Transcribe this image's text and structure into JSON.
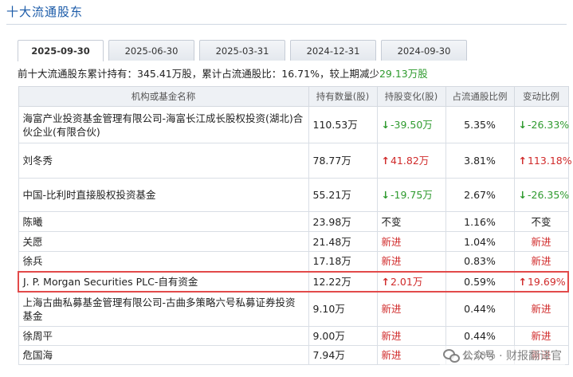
{
  "panel": {
    "title": "十大流通股东"
  },
  "tabs": [
    {
      "label": "2025-09-30",
      "active": true
    },
    {
      "label": "2025-06-30",
      "active": false
    },
    {
      "label": "2025-03-31",
      "active": false
    },
    {
      "label": "2024-12-31",
      "active": false
    },
    {
      "label": "2024-09-30",
      "active": false
    }
  ],
  "summary": {
    "prefix": "前十大流通股东累计持有：",
    "total": "345.41万股",
    "ratio_label": "，累计占流通股比：",
    "ratio": "16.71%",
    "change_label": "，较上期减少",
    "change": "29.13万股"
  },
  "table": {
    "headers": [
      "机构或基金名称",
      "持有数量(股)",
      "持股变化(股)",
      "占流通股比例",
      "变动比例"
    ],
    "rows": [
      {
        "name": "海富产业投资基金管理有限公司-海富长江成长股权投资(湖北)合伙企业(有限合伙)",
        "qty": "110.53万",
        "change": "-39.50万",
        "change_dir": "down",
        "pct": "5.35%",
        "ratio": "-26.33%",
        "ratio_dir": "down"
      },
      {
        "name": "刘冬秀",
        "qty": "78.77万",
        "change": "41.82万",
        "change_dir": "up",
        "pct": "3.81%",
        "ratio": "113.18%",
        "ratio_dir": "up"
      },
      {
        "name": "中国-比利时直接股权投资基金",
        "qty": "55.21万",
        "change": "-19.75万",
        "change_dir": "down",
        "pct": "2.67%",
        "ratio": "-26.35%",
        "ratio_dir": "down"
      },
      {
        "name": "陈曦",
        "qty": "23.98万",
        "change": "不变",
        "change_dir": "none",
        "pct": "1.16%",
        "ratio": "不变",
        "ratio_dir": "none"
      },
      {
        "name": "关愿",
        "qty": "21.48万",
        "change": "新进",
        "change_dir": "new",
        "pct": "1.04%",
        "ratio": "新进",
        "ratio_dir": "new"
      },
      {
        "name": "徐兵",
        "qty": "17.18万",
        "change": "新进",
        "change_dir": "new",
        "pct": "0.83%",
        "ratio": "新进",
        "ratio_dir": "new"
      },
      {
        "name": "J. P. Morgan Securities PLC-自有资金",
        "qty": "12.22万",
        "change": "2.01万",
        "change_dir": "up",
        "pct": "0.59%",
        "ratio": "19.69%",
        "ratio_dir": "up",
        "highlight": true
      },
      {
        "name": "上海古曲私募基金管理有限公司-古曲多策略六号私募证券投资基金",
        "qty": "9.10万",
        "change": "新进",
        "change_dir": "new",
        "pct": "0.44%",
        "ratio": "新进",
        "ratio_dir": "new"
      },
      {
        "name": "徐周平",
        "qty": "9.00万",
        "change": "新进",
        "change_dir": "new",
        "pct": "0.44%",
        "ratio": "新进",
        "ratio_dir": "new"
      },
      {
        "name": "危国海",
        "qty": "7.94万",
        "change": "新进",
        "change_dir": "new",
        "pct": "0.38%",
        "ratio": "新进",
        "ratio_dir": "new"
      }
    ]
  },
  "watermark": {
    "text": "公众号 · 财报翻译官",
    "icon": "wechat-icon"
  },
  "colors": {
    "up": "#d02a2a",
    "down": "#2e9a2e",
    "title": "#1a5aa8",
    "highlight_border": "#e24a4a"
  }
}
